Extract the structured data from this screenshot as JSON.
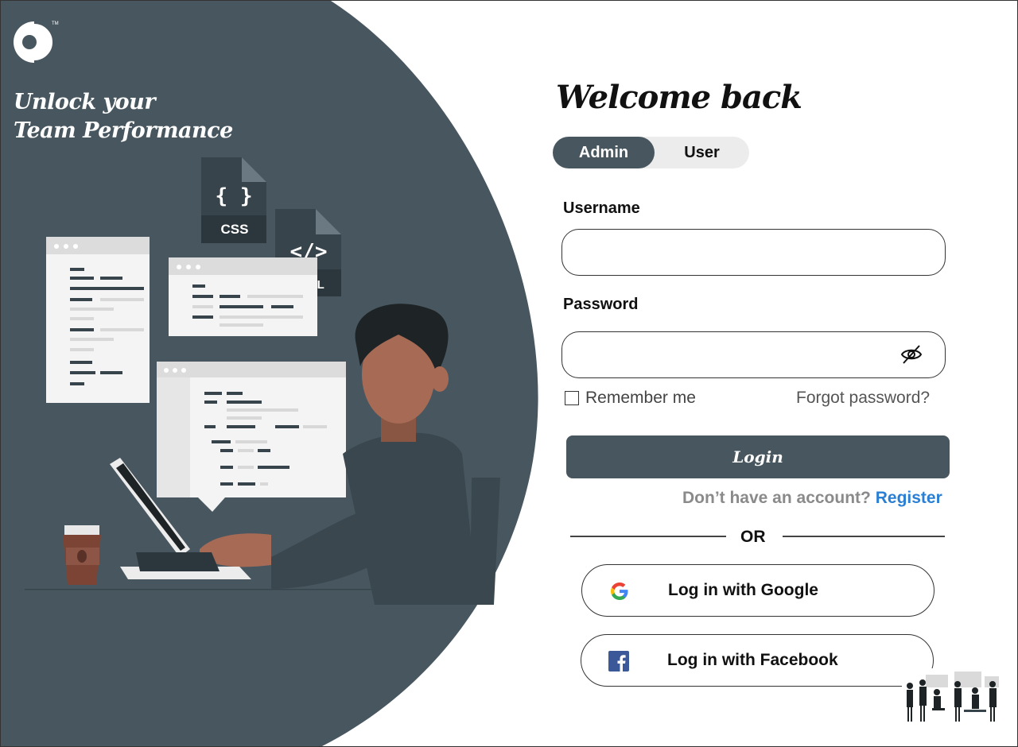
{
  "brand": {
    "tagline_line1": "Unlock your",
    "tagline_line2": "Team Performance",
    "logo_icon": "brand-logo-icon",
    "panel_color": "#48575f"
  },
  "illustration": {
    "css_file_label": "CSS",
    "html_file_label": "HTML",
    "css_glyph": "{ }",
    "html_glyph": "</>"
  },
  "login": {
    "title": "Welcome back",
    "roles": {
      "admin": "Admin",
      "user": "User",
      "selected": "Admin"
    },
    "username_label": "Username",
    "username_value": "",
    "password_label": "Password",
    "password_value": "",
    "password_toggle_icon": "eye-off-icon",
    "remember_label": "Remember me",
    "remember_checked": false,
    "forgot_label": "Forgot password?",
    "submit_label": "Login",
    "register_prompt": "Don’t have an account?",
    "register_link": "Register",
    "divider_label": "OR",
    "google_label": "Log in with Google",
    "google_icon": "google-icon",
    "facebook_label": "Log in with Facebook",
    "facebook_icon": "facebook-icon",
    "accent_color": "#2a7fd4"
  }
}
